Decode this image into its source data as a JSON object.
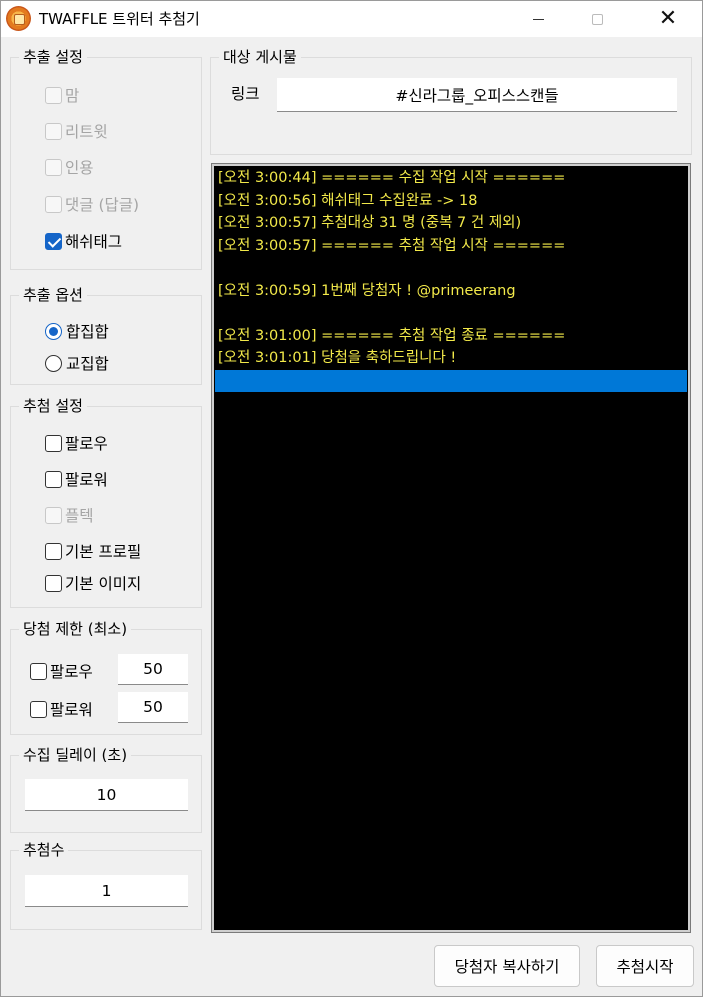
{
  "window": {
    "title": "TWAFFLE 트위터 추첨기"
  },
  "extract_settings": {
    "title": "추출 설정",
    "items": [
      {
        "label": "맘",
        "checked": false,
        "disabled": true
      },
      {
        "label": "리트윗",
        "checked": false,
        "disabled": true
      },
      {
        "label": "인용",
        "checked": false,
        "disabled": true
      },
      {
        "label": "댓글 (답글)",
        "checked": false,
        "disabled": true
      },
      {
        "label": "해쉬태그",
        "checked": true,
        "disabled": false
      }
    ]
  },
  "extract_options": {
    "title": "추출 옵션",
    "items": [
      {
        "label": "합집합",
        "selected": true
      },
      {
        "label": "교집합",
        "selected": false
      }
    ]
  },
  "draw_settings": {
    "title": "추첨 설정",
    "items": [
      {
        "label": "팔로우",
        "checked": false,
        "disabled": false
      },
      {
        "label": "팔로워",
        "checked": false,
        "disabled": false
      },
      {
        "label": "플텍",
        "checked": false,
        "disabled": true
      },
      {
        "label": "기본 프로필",
        "checked": false,
        "disabled": false
      },
      {
        "label": "기본 이미지",
        "checked": false,
        "disabled": false
      }
    ]
  },
  "win_limit": {
    "title": "당첨 제한 (최소)",
    "follow_label": "팔로우",
    "follow_value": "50",
    "follower_label": "팔로워",
    "follower_value": "50"
  },
  "collect_delay": {
    "title": "수집 딜레이 (초)",
    "value": "10"
  },
  "draw_count": {
    "title": "추첨수",
    "value": "1"
  },
  "target_post": {
    "title": "대상 게시물",
    "link_label": "링크",
    "link_value": "#신라그룹_오피스스캔들"
  },
  "log": {
    "lines": [
      "[오전 3:00:44] ====== 수집 작업 시작 ======",
      "[오전 3:00:56] 해쉬태그 수집완료 -> 18",
      "[오전 3:00:57] 추첨대상 31 명 (중복 7 건 제외)",
      "[오전 3:00:57] ====== 추첨 작업 시작 ======",
      "",
      "[오전 3:00:59] 1번째 당첨자 ! @primeerang",
      "",
      "[오전 3:01:00] ====== 추첨 작업 종료 ======",
      "[오전 3:01:01] 당첨을 축하드립니다 !",
      ""
    ],
    "selected_index": 9
  },
  "buttons": {
    "copy_winner": "당첨자 복사하기",
    "start_draw": "추첨시작"
  }
}
